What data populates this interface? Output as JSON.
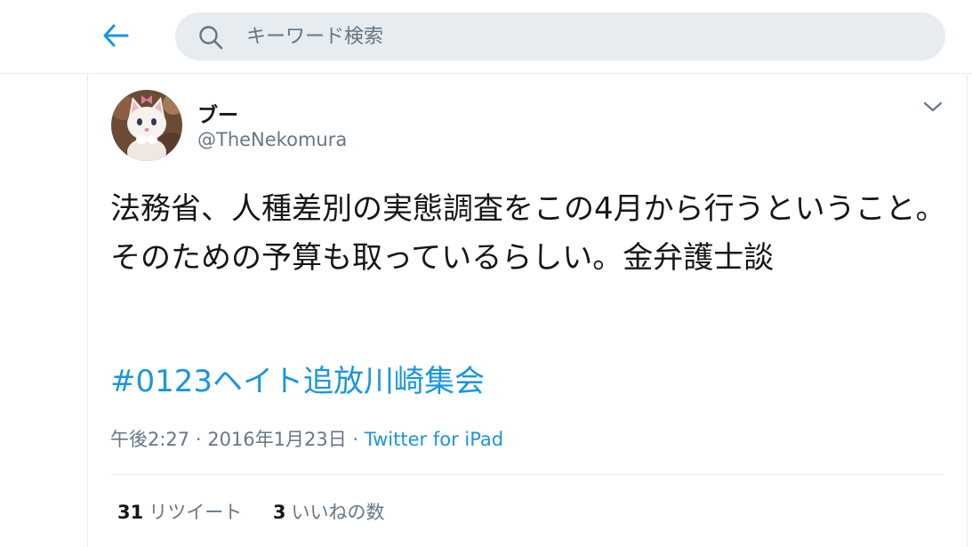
{
  "header": {
    "back_icon": "arrow-left-icon",
    "search_icon": "search-icon",
    "search_placeholder": "キーワード検索"
  },
  "tweet": {
    "display_name": "ブー",
    "handle": "@TheNekomura",
    "text": "法務省、人種差別の実態調査をこの4月から行うということ。そのための予算も取っているらしい。金弁護士談",
    "hashtag": "#0123ヘイト追放川崎集会",
    "time": "午後2:27",
    "separator1": " · ",
    "date": "2016年1月23日",
    "separator2": " · ",
    "source": "Twitter for iPad",
    "caret_icon": "chevron-down-icon"
  },
  "stats": {
    "retweets_count": "31",
    "retweets_label": "リツイート",
    "likes_count": "3",
    "likes_label": "いいねの数"
  },
  "colors": {
    "accent": "#1b95e0",
    "secondary_text": "#657786",
    "search_bg": "#e6ecf0",
    "border": "#e6ecf0"
  }
}
